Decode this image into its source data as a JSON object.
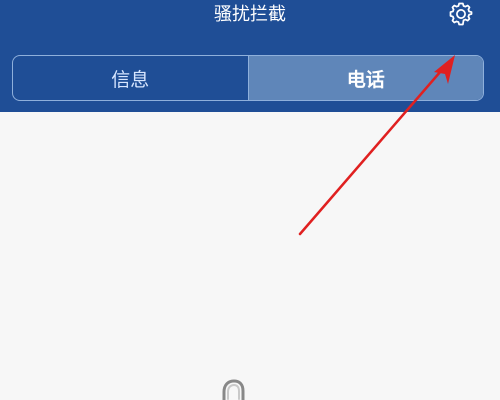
{
  "app": {
    "title": "骚扰拦截"
  },
  "header": {
    "settings_icon": "gear-icon"
  },
  "tabs": [
    {
      "label": "信息",
      "selected": false
    },
    {
      "label": "电话",
      "selected": true
    }
  ],
  "annotation": {
    "arrow_color": "#e02020"
  },
  "empty_state": {
    "icon": "empty-state-icon"
  },
  "colors": {
    "header": "#1f4e96",
    "active_tab": "#5f86b9",
    "background": "#f7f7f7"
  }
}
